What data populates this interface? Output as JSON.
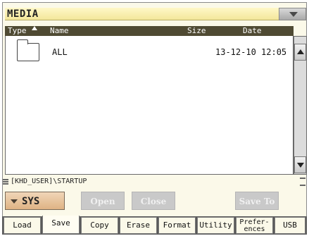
{
  "window": {
    "title": "MEDIA"
  },
  "columns": {
    "type": "Type",
    "name": "Name",
    "size": "Size",
    "date": "Date"
  },
  "files": [
    {
      "name": "ALL",
      "size": "",
      "date": "13-12-10 12:05",
      "icon": "folder-icon"
    }
  ],
  "path": "[KHD_USER]\\STARTUP",
  "actions": {
    "device": "SYS",
    "open": "Open",
    "close": "Close",
    "save_to": "Save To"
  },
  "tabs": [
    {
      "label": "Load",
      "active": false
    },
    {
      "label": "Save",
      "active": true
    },
    {
      "label": "Copy",
      "active": false
    },
    {
      "label": "Erase",
      "active": false
    },
    {
      "label": "Format",
      "active": false
    },
    {
      "label": "Utility",
      "active": false
    },
    {
      "label": "Prefer-\nences",
      "active": false
    },
    {
      "label": "USB",
      "active": false
    }
  ],
  "colors": {
    "title_bar": "#f3e79a",
    "header_bg": "#4f4a33",
    "sys_button": "#dfb384",
    "disabled_button": "#c9c9c9"
  }
}
